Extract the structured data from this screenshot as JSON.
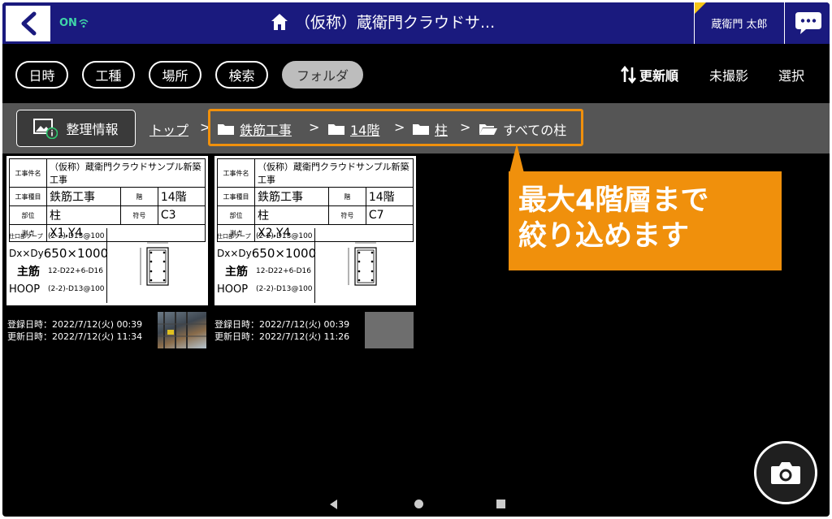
{
  "header": {
    "online_label": "ON",
    "title": "（仮称）蔵衛門クラウドサ...",
    "user_name": "蔵衛門 太郎"
  },
  "filters": {
    "items": [
      "日時",
      "工種",
      "場所",
      "検索",
      "フォルダ"
    ],
    "active": "フォルダ"
  },
  "toolbar": {
    "sort_label": "更新順",
    "unshot_label": "未撮影",
    "select_label": "選択"
  },
  "breadcrumb": {
    "org_button": "整理情報",
    "top": "トップ",
    "separator": ">",
    "items": [
      "鉄筋工事",
      "14階",
      "柱",
      "すべての柱"
    ]
  },
  "callout": {
    "line1": "最大4階層まで",
    "line2": "絞り込めます"
  },
  "photos": [
    {
      "board": {
        "project_key": "工事件名",
        "project": "（仮称）蔵衛門クラウドサンプル新築工事",
        "type_key": "工事種目",
        "type": "鉄筋工事",
        "floor_key": "階",
        "floor": "14階",
        "part_key": "部位",
        "part": "柱",
        "code_key": "符号",
        "code": "C3",
        "point_key": "測点",
        "point": "X1,Y4",
        "hoop_key": "仕口部フープ",
        "hoop": "(2-2)-D13@100",
        "size_key": "Dx×Dy",
        "size": "650×1000",
        "main_key": "主筋",
        "main": "12-D22+6-D16",
        "hoop2_key": "HOOP",
        "hoop2": "(2-2)-D13@100"
      },
      "registered": "登録日時：2022/7/12(火)  00:39",
      "updated": "更新日時：2022/7/12(火)  11:34"
    },
    {
      "board": {
        "project_key": "工事件名",
        "project": "（仮称）蔵衛門クラウドサンプル新築工事",
        "type_key": "工事種目",
        "type": "鉄筋工事",
        "floor_key": "階",
        "floor": "14階",
        "part_key": "部位",
        "part": "柱",
        "code_key": "符号",
        "code": "C7",
        "point_key": "測点",
        "point": "X2,Y4",
        "hoop_key": "仕口部フープ",
        "hoop": "(2-2)-D13@100",
        "size_key": "Dx×Dy",
        "size": "650×1000",
        "main_key": "主筋",
        "main": "12-D22+6-D16",
        "hoop2_key": "HOOP",
        "hoop2": "(2-2)-D13@100"
      },
      "registered": "登録日時：2022/7/12(火)  00:39",
      "updated": "更新日時：2022/7/12(火)  11:26"
    }
  ],
  "colors": {
    "header_bg": "#1a1a7e",
    "accent_orange": "#f0900c",
    "online_green": "#3fd6a8",
    "user_flag": "#f5c518"
  }
}
